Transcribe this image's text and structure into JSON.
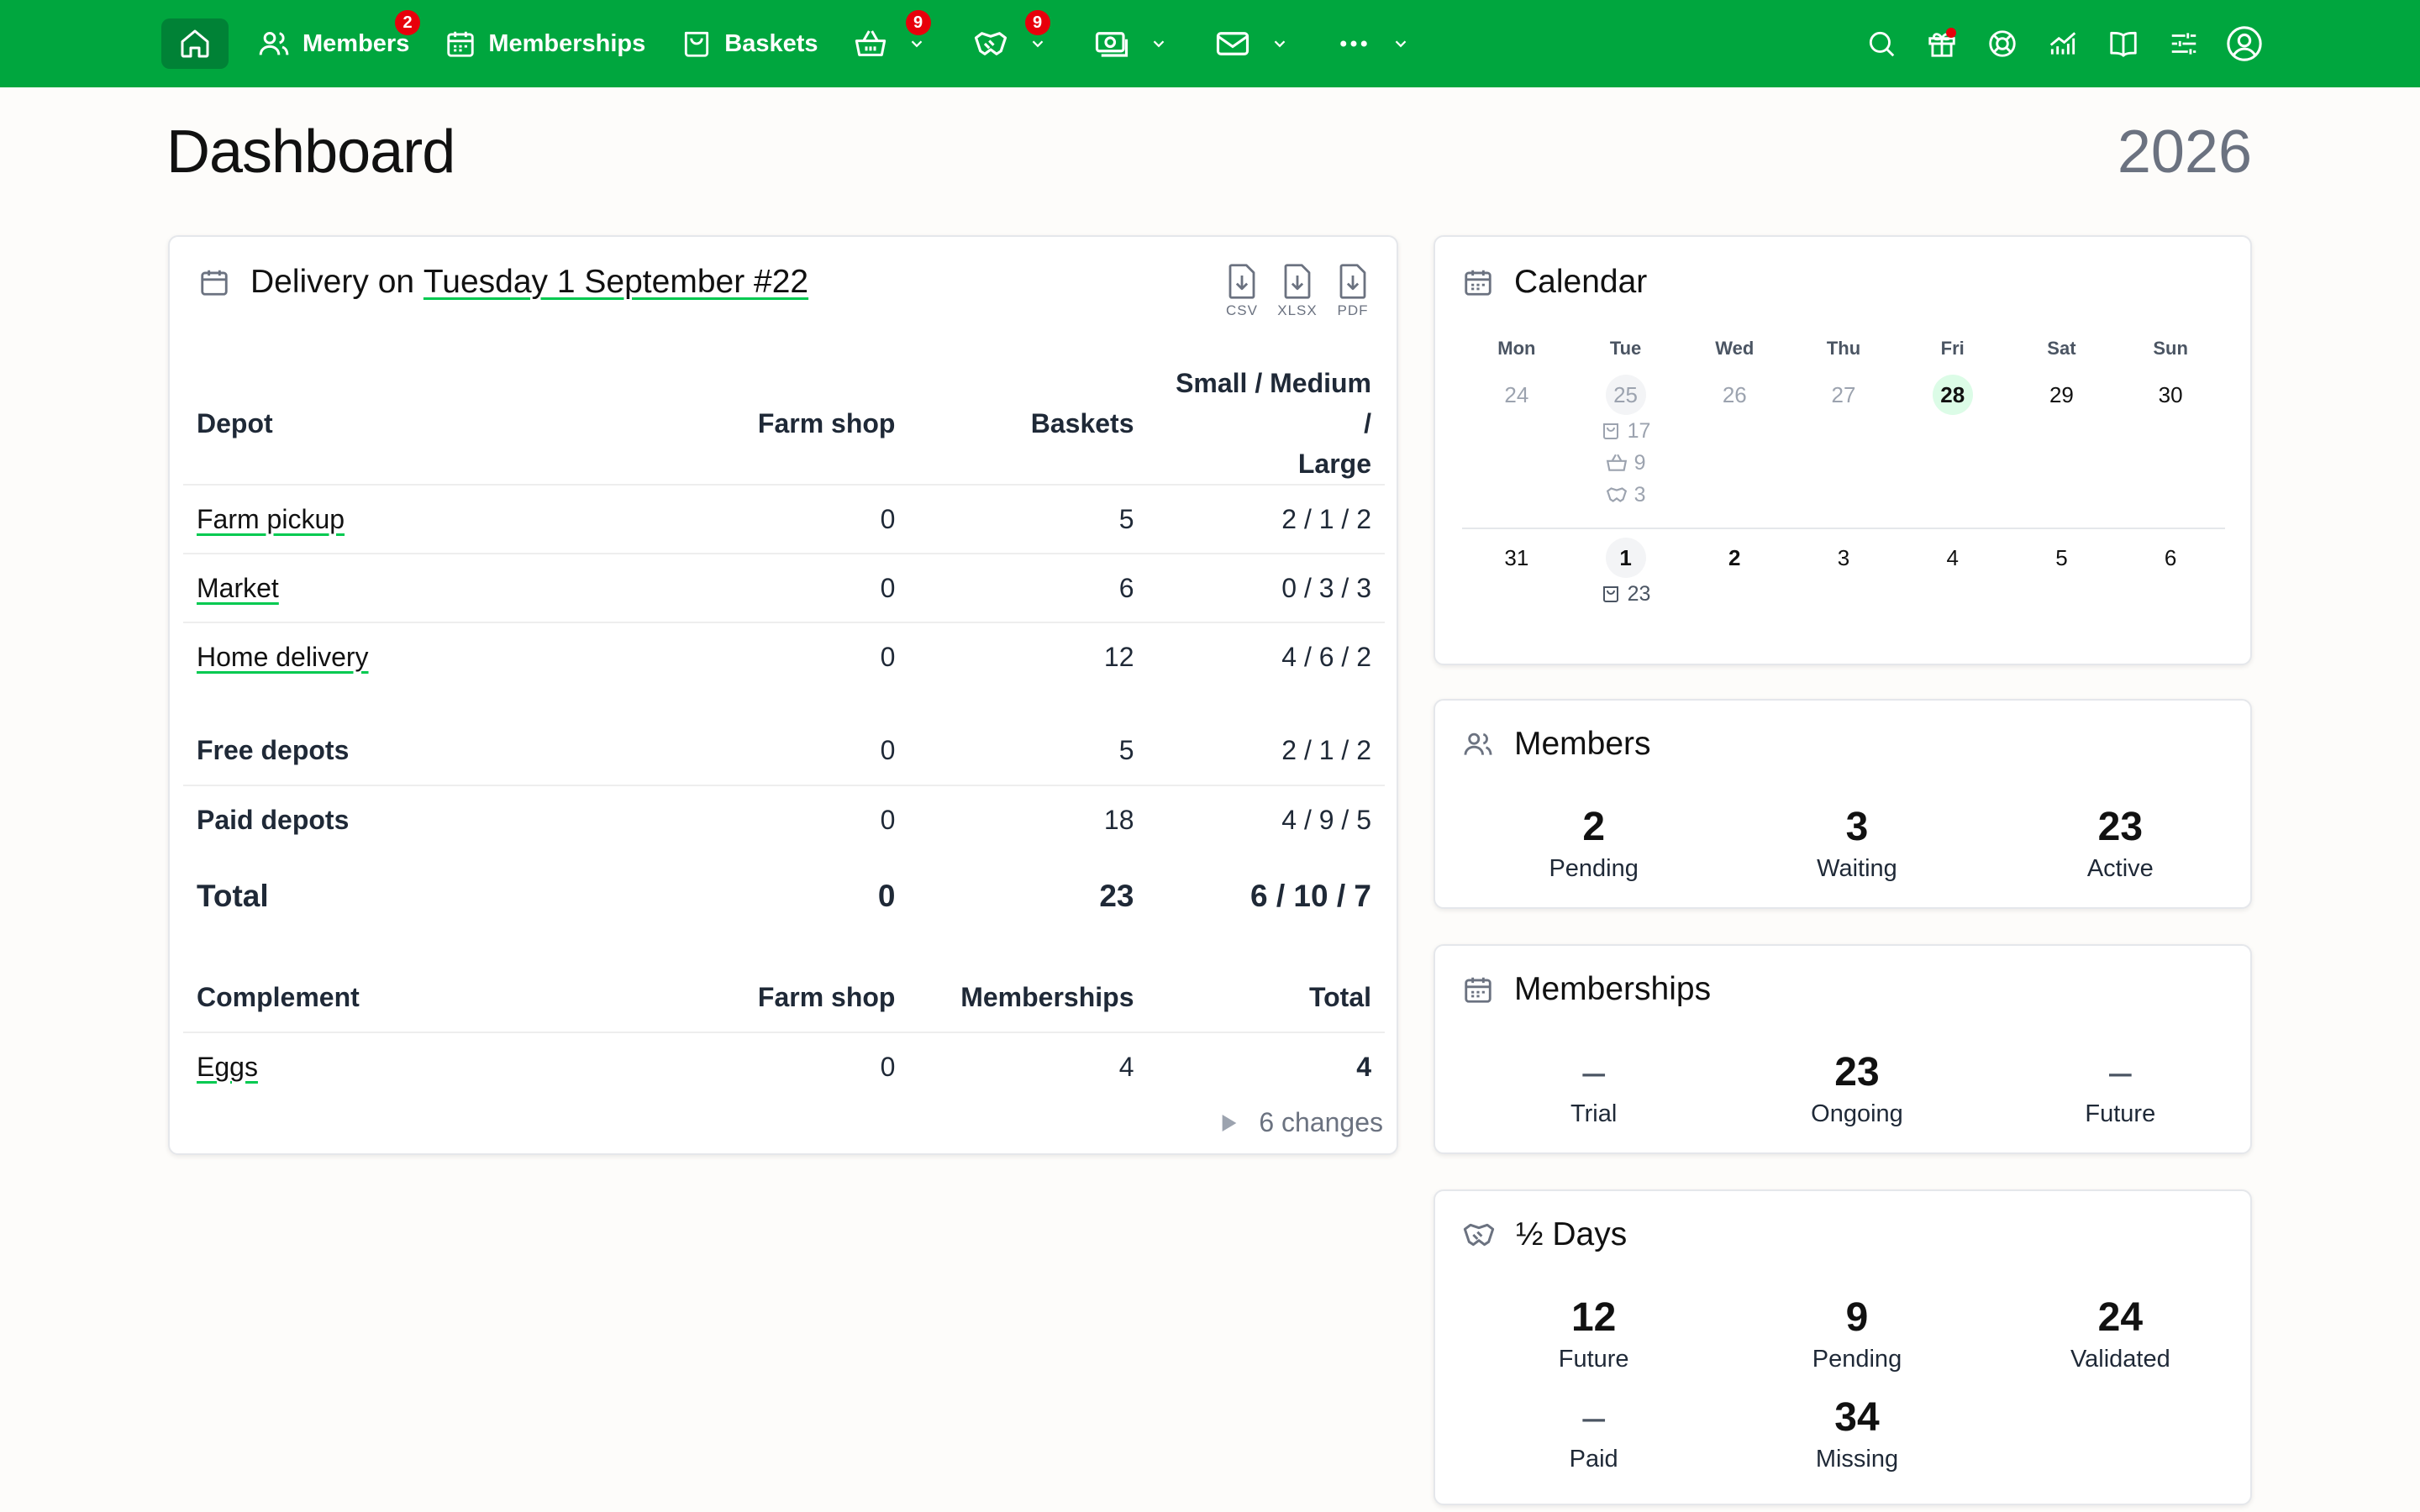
{
  "nav": {
    "members_label": "Members",
    "members_badge": "2",
    "memberships_label": "Memberships",
    "baskets_label": "Baskets",
    "complements_badge": "9",
    "halfdays_badge": "9"
  },
  "page": {
    "title": "Dashboard",
    "year": "2026"
  },
  "delivery": {
    "title_prefix": "Delivery on",
    "title_link": "Tuesday 1 September #22",
    "exports": [
      "CSV",
      "XLSX",
      "PDF"
    ],
    "headers": {
      "depot": "Depot",
      "farm_shop": "Farm shop",
      "baskets": "Baskets",
      "sizes_1": "Small / Medium /",
      "sizes_2": "Large"
    },
    "rows": [
      {
        "depot": "Farm pickup",
        "farm_shop": "0",
        "baskets": "5",
        "sizes": "2 / 1 / 2"
      },
      {
        "depot": "Market",
        "farm_shop": "0",
        "baskets": "6",
        "sizes": "0 / 3 / 3"
      },
      {
        "depot": "Home delivery",
        "farm_shop": "0",
        "baskets": "12",
        "sizes": "4 / 6 / 2"
      }
    ],
    "summary": [
      {
        "depot": "Free depots",
        "farm_shop": "0",
        "baskets": "5",
        "sizes": "2 / 1 / 2"
      },
      {
        "depot": "Paid depots",
        "farm_shop": "0",
        "baskets": "18",
        "sizes": "4 / 9 / 5"
      }
    ],
    "total": {
      "label": "Total",
      "farm_shop": "0",
      "baskets": "23",
      "sizes": "6 / 10 / 7"
    },
    "complement_headers": {
      "complement": "Complement",
      "farm_shop": "Farm shop",
      "memberships": "Memberships",
      "total": "Total"
    },
    "complements": [
      {
        "name": "Eggs",
        "farm_shop": "0",
        "memberships": "4",
        "total": "4"
      }
    ],
    "changes": "6 changes"
  },
  "calendar": {
    "title": "Calendar",
    "dow": [
      "Mon",
      "Tue",
      "Wed",
      "Thu",
      "Fri",
      "Sat",
      "Sun"
    ],
    "week1": [
      "24",
      "25",
      "26",
      "27",
      "28",
      "29",
      "30"
    ],
    "week1_events": {
      "baskets": "17",
      "complements": "9",
      "halfdays": "3"
    },
    "week2": [
      "31",
      "1",
      "2",
      "3",
      "4",
      "5",
      "6"
    ],
    "week2_events": {
      "baskets": "23"
    }
  },
  "members": {
    "title": "Members",
    "stats": [
      {
        "value": "2",
        "label": "Pending"
      },
      {
        "value": "3",
        "label": "Waiting"
      },
      {
        "value": "23",
        "label": "Active"
      }
    ]
  },
  "memberships": {
    "title": "Memberships",
    "stats": [
      {
        "value": "–",
        "label": "Trial"
      },
      {
        "value": "23",
        "label": "Ongoing"
      },
      {
        "value": "–",
        "label": "Future"
      }
    ]
  },
  "halfdays": {
    "title": "½ Days",
    "stats": [
      {
        "value": "12",
        "label": "Future"
      },
      {
        "value": "9",
        "label": "Pending"
      },
      {
        "value": "24",
        "label": "Validated"
      },
      {
        "value": "–",
        "label": "Paid"
      },
      {
        "value": "34",
        "label": "Missing"
      }
    ]
  }
}
